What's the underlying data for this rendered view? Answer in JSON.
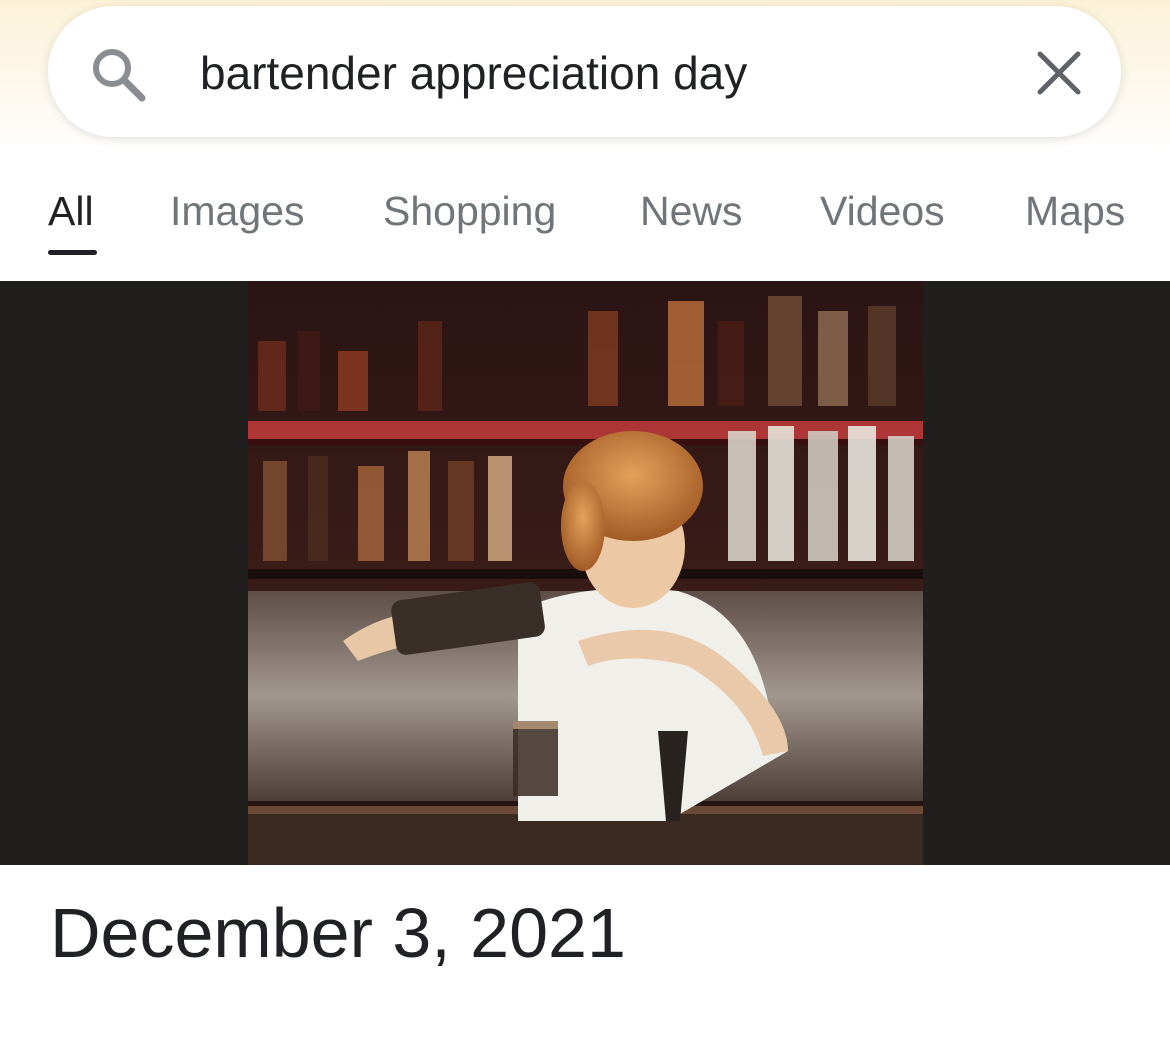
{
  "search": {
    "query": "bartender appreciation day"
  },
  "tabs": [
    {
      "label": "All",
      "active": true
    },
    {
      "label": "Images",
      "active": false
    },
    {
      "label": "Shopping",
      "active": false
    },
    {
      "label": "News",
      "active": false
    },
    {
      "label": "Videos",
      "active": false
    },
    {
      "label": "Maps",
      "active": false
    }
  ],
  "icons": {
    "search": "search-icon",
    "clear": "close-icon"
  },
  "result": {
    "date": "December 3, 2021"
  },
  "colors": {
    "text_primary": "#202124",
    "text_secondary": "#70757a",
    "image_background": "#211e1e"
  }
}
